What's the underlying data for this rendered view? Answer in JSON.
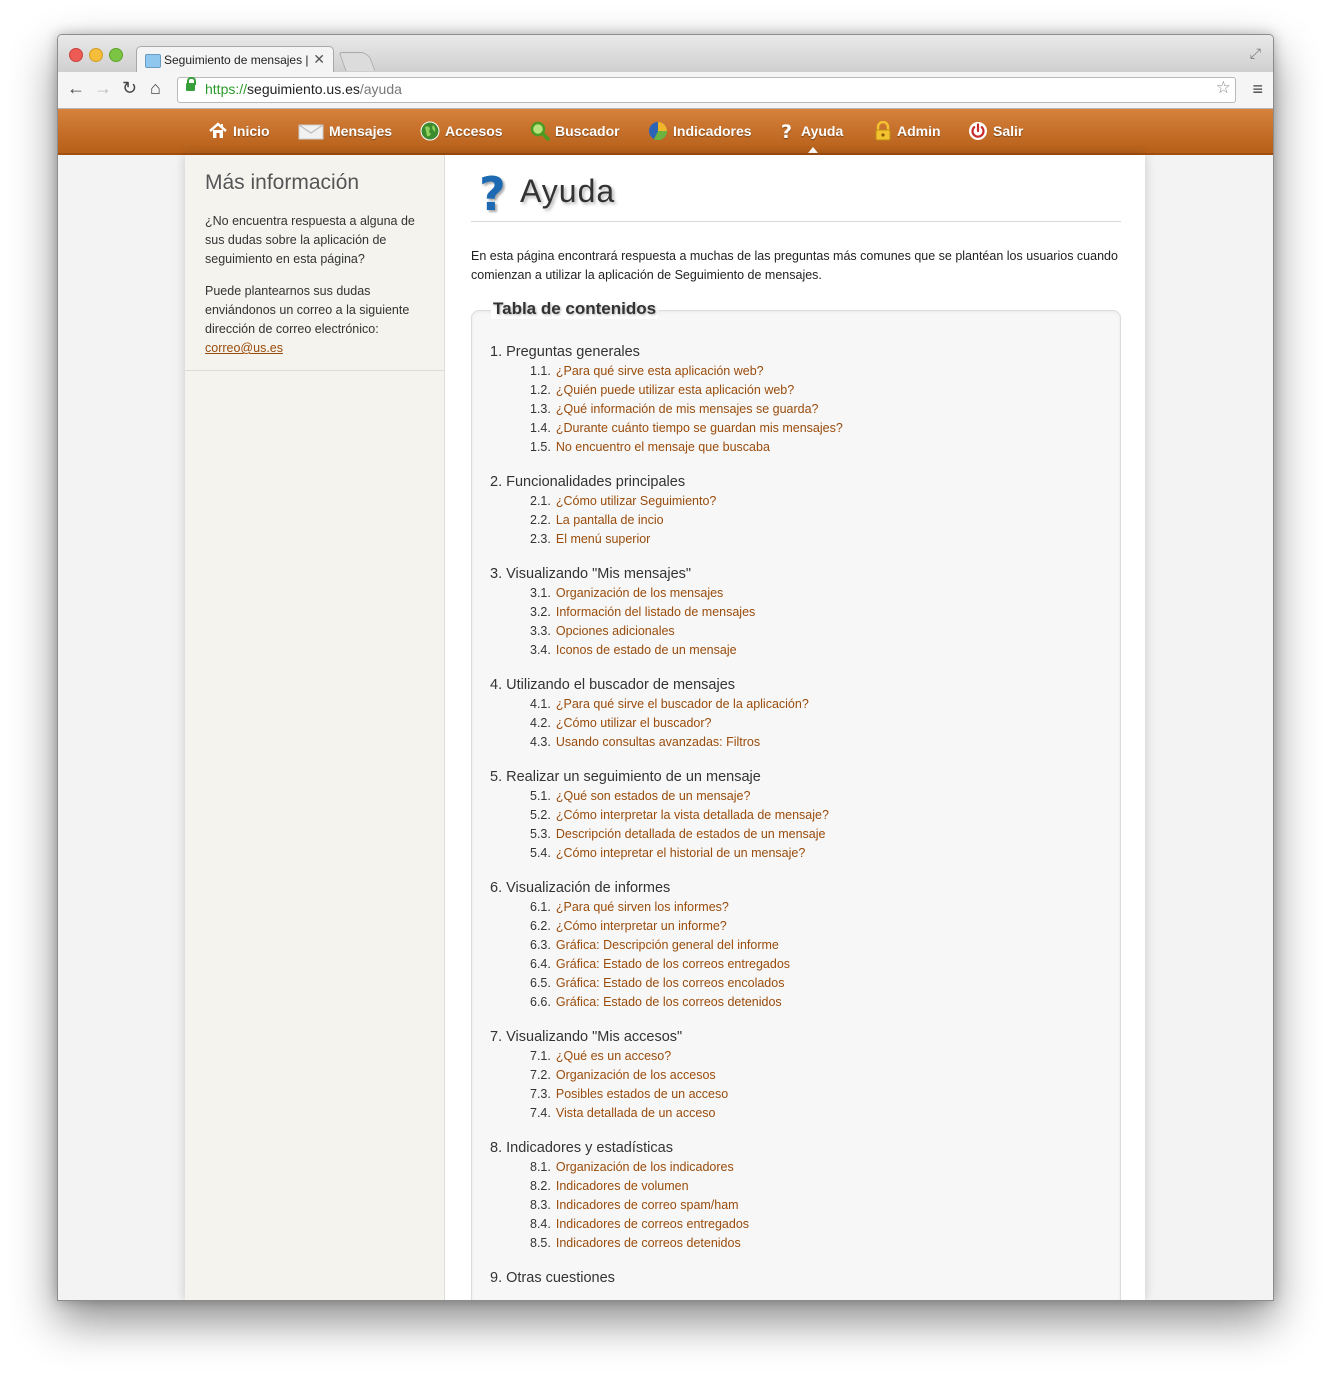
{
  "browser": {
    "tab_title": "Seguimiento de mensajes | A",
    "url_protocol": "https://",
    "url_host": "seguimiento.us.es",
    "url_path": "/ayuda"
  },
  "nav": [
    {
      "label": "Inicio",
      "icon": "home-icon"
    },
    {
      "label": "Mensajes",
      "icon": "envelope-icon"
    },
    {
      "label": "Accesos",
      "icon": "globe-icon"
    },
    {
      "label": "Buscador",
      "icon": "search-icon"
    },
    {
      "label": "Indicadores",
      "icon": "pie-chart-icon"
    },
    {
      "label": "Ayuda",
      "icon": "help-icon"
    },
    {
      "label": "Admin",
      "icon": "lock-icon"
    },
    {
      "label": "Salir",
      "icon": "power-icon"
    }
  ],
  "sidebar": {
    "title": "Más información",
    "p1": "¿No encuentra respuesta a alguna de sus dudas sobre la aplicación de seguimiento en esta página?",
    "p2": "Puede plantearnos sus dudas enviándonos un correo a la siguiente dirección de correo electrónico:",
    "email": "correo@us.es"
  },
  "main": {
    "title": "Ayuda",
    "intro": "En esta página encontrará respuesta a muchas de las preguntas más comunes que se plantéan los usuarios cuando comienzan a utilizar la aplicación de Seguimiento de mensajes.",
    "toc_title": "Tabla de contenidos",
    "sections": [
      {
        "title": "1. Preguntas generales",
        "items": [
          {
            "num": "1.1.",
            "text": "¿Para qué sirve esta aplicación web?"
          },
          {
            "num": "1.2.",
            "text": "¿Quién puede utilizar esta aplicación web?"
          },
          {
            "num": "1.3.",
            "text": "¿Qué información de mis mensajes se guarda?"
          },
          {
            "num": "1.4.",
            "text": "¿Durante cuánto tiempo se guardan mis mensajes?"
          },
          {
            "num": "1.5.",
            "text": "No encuentro el mensaje que buscaba"
          }
        ]
      },
      {
        "title": "2. Funcionalidades principales",
        "items": [
          {
            "num": "2.1.",
            "text": "¿Cómo utilizar Seguimiento?"
          },
          {
            "num": "2.2.",
            "text": "La pantalla de incio"
          },
          {
            "num": "2.3.",
            "text": "El menú superior"
          }
        ]
      },
      {
        "title": "3. Visualizando \"Mis mensajes\"",
        "items": [
          {
            "num": "3.1.",
            "text": "Organización de los mensajes"
          },
          {
            "num": "3.2.",
            "text": "Información del listado de mensajes"
          },
          {
            "num": "3.3.",
            "text": "Opciones adicionales"
          },
          {
            "num": "3.4.",
            "text": "Iconos de estado de un mensaje"
          }
        ]
      },
      {
        "title": "4. Utilizando el buscador de mensajes",
        "items": [
          {
            "num": "4.1.",
            "text": "¿Para qué sirve el buscador de la aplicación?"
          },
          {
            "num": "4.2.",
            "text": "¿Cómo utilizar el buscador?"
          },
          {
            "num": "4.3.",
            "text": "Usando consultas avanzadas: Filtros"
          }
        ]
      },
      {
        "title": "5. Realizar un seguimiento de un mensaje",
        "items": [
          {
            "num": "5.1.",
            "text": "¿Qué son estados de un mensaje?"
          },
          {
            "num": "5.2.",
            "text": "¿Cómo interpretar la vista detallada de mensaje?"
          },
          {
            "num": "5.3.",
            "text": "Descripción detallada de estados de un mensaje"
          },
          {
            "num": "5.4.",
            "text": "¿Cómo intepretar el historial de un mensaje?"
          }
        ]
      },
      {
        "title": "6. Visualización de informes",
        "items": [
          {
            "num": "6.1.",
            "text": "¿Para qué sirven los informes?"
          },
          {
            "num": "6.2.",
            "text": "¿Cómo interpretar un informe?"
          },
          {
            "num": "6.3.",
            "text": "Gráfica: Descripción general del informe"
          },
          {
            "num": "6.4.",
            "text": "Gráfica: Estado de los correos entregados"
          },
          {
            "num": "6.5.",
            "text": "Gráfica: Estado de los correos encolados"
          },
          {
            "num": "6.6.",
            "text": "Gráfica: Estado de los correos detenidos"
          }
        ]
      },
      {
        "title": "7. Visualizando \"Mis accesos\"",
        "items": [
          {
            "num": "7.1.",
            "text": "¿Qué es un acceso?"
          },
          {
            "num": "7.2.",
            "text": "Organización de los accesos"
          },
          {
            "num": "7.3.",
            "text": "Posibles estados de un acceso"
          },
          {
            "num": "7.4.",
            "text": "Vista detallada de un acceso"
          }
        ]
      },
      {
        "title": "8. Indicadores y estadísticas",
        "items": [
          {
            "num": "8.1.",
            "text": "Organización de los indicadores"
          },
          {
            "num": "8.2.",
            "text": "Indicadores de volumen"
          },
          {
            "num": "8.3.",
            "text": "Indicadores de correo spam/ham"
          },
          {
            "num": "8.4.",
            "text": "Indicadores de correos entregados"
          },
          {
            "num": "8.5.",
            "text": "Indicadores de correos detenidos"
          }
        ]
      },
      {
        "title": "9. Otras cuestiones",
        "items": []
      }
    ]
  },
  "colors": {
    "nav_bar": "#c46f28",
    "link": "#9a4c0c",
    "sidebar_bg": "#f4f3ee"
  }
}
